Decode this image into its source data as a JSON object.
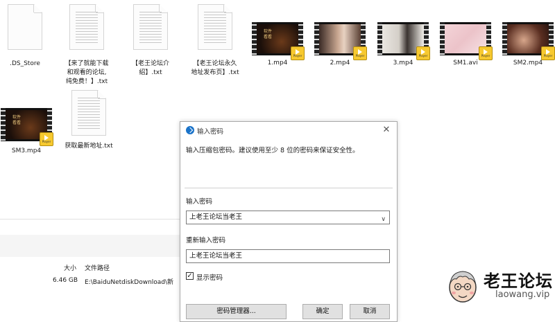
{
  "files": [
    {
      "name": ".DS_Store",
      "kind": "doc-blank"
    },
    {
      "name": "【来了就能下载\n和观看的论坛,\n纯免费！】.txt",
      "kind": "doc-lined"
    },
    {
      "name": "【老王论坛介\n绍】.txt",
      "kind": "doc-lined"
    },
    {
      "name": "【老王论坛永久\n地址发布页】.txt",
      "kind": "doc-lined"
    },
    {
      "name": "1.mp4",
      "kind": "video",
      "frame_text": "软件\n看看"
    },
    {
      "name": "2.mp4",
      "kind": "video"
    },
    {
      "name": "3.mp4",
      "kind": "video"
    },
    {
      "name": "SM1.avi",
      "kind": "video"
    },
    {
      "name": "SM2.mp4",
      "kind": "video"
    },
    {
      "name": "SM3.mp4",
      "kind": "video",
      "frame_text": "软件\n看看"
    },
    {
      "name": "获取最新地址.txt",
      "kind": "doc-lined"
    }
  ],
  "badge_text": "Player",
  "details": {
    "col_size_header": "大小",
    "col_path_header": "文件路径",
    "size_value": "6.46 GB",
    "path_value": "E:\\BaiduNetdiskDownload\\新"
  },
  "dialog": {
    "title": "输入密码",
    "close_glyph": "✕",
    "message": "输入压缩包密码。建议使用至少 8 位的密码来保证安全性。",
    "password_label": "输入密码",
    "password_value": "上老王论坛当老王",
    "chevron_glyph": "∨",
    "confirm_label": "重新输入密码",
    "confirm_value": "上老王论坛当老王",
    "show_password_label": "显示密码",
    "show_password_checked": true,
    "check_glyph": "✓",
    "manager_button": "密码管理器...",
    "ok_button": "确定",
    "cancel_button": "取消"
  },
  "watermark": {
    "title": "老王论坛",
    "url": "laowang.vip"
  },
  "colors": {
    "dialog_icon": "#1a73c9",
    "badge": "#f7c92f"
  }
}
